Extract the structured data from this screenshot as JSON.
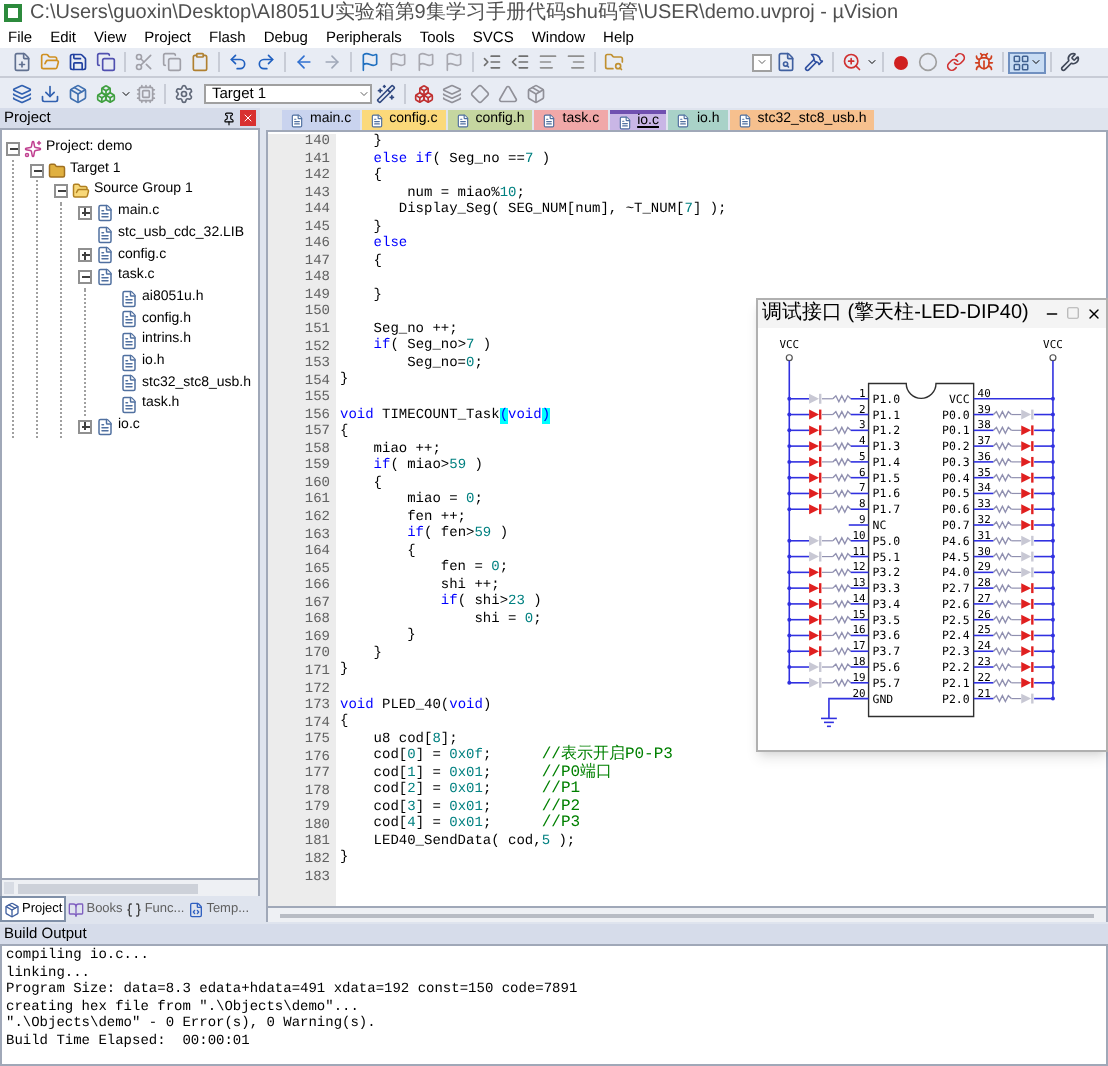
{
  "window": {
    "title": "C:\\Users\\guoxin\\Desktop\\AI8051U实验箱第9集学习手册代码shu码管\\USER\\demo.uvproj - µVision"
  },
  "menu": [
    "File",
    "Edit",
    "View",
    "Project",
    "Flash",
    "Debug",
    "Peripherals",
    "Tools",
    "SVCS",
    "Window",
    "Help"
  ],
  "toolbar": {
    "target": "Target 1"
  },
  "project_panel": {
    "title": "Project",
    "tree": [
      {
        "label": "Project: demo",
        "kind": "project",
        "expanded": true,
        "children": [
          {
            "label": "Target 1",
            "kind": "target",
            "expanded": true,
            "children": [
              {
                "label": "Source Group 1",
                "kind": "group",
                "expanded": true,
                "children": [
                  {
                    "label": "main.c",
                    "kind": "file",
                    "expanded": false
                  },
                  {
                    "label": "stc_usb_cdc_32.LIB",
                    "kind": "file"
                  },
                  {
                    "label": "config.c",
                    "kind": "file",
                    "expanded": false
                  },
                  {
                    "label": "task.c",
                    "kind": "file",
                    "expanded": true,
                    "children": [
                      {
                        "label": "ai8051u.h",
                        "kind": "file"
                      },
                      {
                        "label": "config.h",
                        "kind": "file"
                      },
                      {
                        "label": "intrins.h",
                        "kind": "file"
                      },
                      {
                        "label": "io.h",
                        "kind": "file"
                      },
                      {
                        "label": "stc32_stc8_usb.h",
                        "kind": "file"
                      },
                      {
                        "label": "task.h",
                        "kind": "file"
                      }
                    ]
                  },
                  {
                    "label": "io.c",
                    "kind": "file",
                    "expanded": false
                  }
                ]
              }
            ]
          }
        ]
      }
    ],
    "tabs": [
      {
        "label": "Project",
        "kind": "project",
        "selected": true
      },
      {
        "label": "Books",
        "kind": "books",
        "selected": false
      },
      {
        "label": "Func...",
        "kind": "functions",
        "selected": false
      },
      {
        "label": "Temp...",
        "kind": "templates",
        "selected": false
      }
    ]
  },
  "editor": {
    "tabs": [
      {
        "label": "main.c",
        "color": "#c9d3ee",
        "selected": false
      },
      {
        "label": "config.c",
        "color": "#fbd97a",
        "selected": false
      },
      {
        "label": "config.h",
        "color": "#c5d6a0",
        "selected": false
      },
      {
        "label": "task.c",
        "color": "#f0a8a8",
        "selected": false
      },
      {
        "label": "io.c",
        "color": "#c9b6e6",
        "selected": true
      },
      {
        "label": "io.h",
        "color": "#a9d2c8",
        "selected": false
      },
      {
        "label": "stc32_stc8_usb.h",
        "color": "#f6c08e",
        "selected": false
      }
    ],
    "lines": [
      {
        "number": "140",
        "tokens": [
          {
            "text": "    }",
            "kind": "plain"
          }
        ]
      },
      {
        "number": "141",
        "tokens": [
          {
            "text": "    else if",
            "kind": "keyword"
          },
          {
            "text": "( Seg_no ==",
            "kind": "plain"
          },
          {
            "text": "7",
            "kind": "number"
          },
          {
            "text": " )",
            "kind": "plain"
          }
        ]
      },
      {
        "number": "142",
        "tokens": [
          {
            "text": "    {",
            "kind": "plain"
          }
        ]
      },
      {
        "number": "143",
        "tokens": [
          {
            "text": "        num = miao%",
            "kind": "plain"
          },
          {
            "text": "10",
            "kind": "number"
          },
          {
            "text": ";",
            "kind": "plain"
          }
        ]
      },
      {
        "number": "144",
        "tokens": [
          {
            "text": "       Display_Seg( SEG_NUM[num], ~T_NUM[",
            "kind": "plain"
          },
          {
            "text": "7",
            "kind": "number"
          },
          {
            "text": "] );",
            "kind": "plain"
          }
        ]
      },
      {
        "number": "145",
        "tokens": [
          {
            "text": "    }",
            "kind": "plain"
          }
        ]
      },
      {
        "number": "146",
        "tokens": [
          {
            "text": "    else",
            "kind": "keyword"
          }
        ]
      },
      {
        "number": "147",
        "tokens": [
          {
            "text": "    {",
            "kind": "plain"
          }
        ]
      },
      {
        "number": "148"
      },
      {
        "number": "149",
        "tokens": [
          {
            "text": "    }",
            "kind": "plain"
          }
        ]
      },
      {
        "number": "150"
      },
      {
        "number": "151",
        "tokens": [
          {
            "text": "    Seg_no ++;",
            "kind": "plain"
          }
        ]
      },
      {
        "number": "152",
        "tokens": [
          {
            "text": "    if",
            "kind": "keyword"
          },
          {
            "text": "( Seg_no>",
            "kind": "plain"
          },
          {
            "text": "7",
            "kind": "number"
          },
          {
            "text": " )",
            "kind": "plain"
          }
        ]
      },
      {
        "number": "153",
        "tokens": [
          {
            "text": "        Seg_no=",
            "kind": "plain"
          },
          {
            "text": "0",
            "kind": "number"
          },
          {
            "text": ";",
            "kind": "plain"
          }
        ]
      },
      {
        "number": "154",
        "tokens": [
          {
            "text": "}",
            "kind": "plain"
          }
        ]
      },
      {
        "number": "155"
      },
      {
        "number": "156",
        "tokens": [
          {
            "text": "void",
            "kind": "keyword"
          },
          {
            "text": " TIMECOUNT_Task",
            "kind": "plain"
          },
          {
            "text": "(",
            "kind": "match"
          },
          {
            "text": "void",
            "kind": "keyword"
          },
          {
            "text": ")",
            "kind": "match"
          }
        ]
      },
      {
        "number": "157",
        "tokens": [
          {
            "text": "{",
            "kind": "plain"
          }
        ]
      },
      {
        "number": "158",
        "tokens": [
          {
            "text": "    miao ++;",
            "kind": "plain"
          }
        ]
      },
      {
        "number": "159",
        "tokens": [
          {
            "text": "    if",
            "kind": "keyword"
          },
          {
            "text": "( miao>",
            "kind": "plain"
          },
          {
            "text": "59",
            "kind": "number"
          },
          {
            "text": " )",
            "kind": "plain"
          }
        ]
      },
      {
        "number": "160",
        "tokens": [
          {
            "text": "    {",
            "kind": "plain"
          }
        ]
      },
      {
        "number": "161",
        "tokens": [
          {
            "text": "        miao = ",
            "kind": "plain"
          },
          {
            "text": "0",
            "kind": "number"
          },
          {
            "text": ";",
            "kind": "plain"
          }
        ]
      },
      {
        "number": "162",
        "tokens": [
          {
            "text": "        fen ++;",
            "kind": "plain"
          }
        ]
      },
      {
        "number": "163",
        "tokens": [
          {
            "text": "        if",
            "kind": "keyword"
          },
          {
            "text": "( fen>",
            "kind": "plain"
          },
          {
            "text": "59",
            "kind": "number"
          },
          {
            "text": " )",
            "kind": "plain"
          }
        ]
      },
      {
        "number": "164",
        "tokens": [
          {
            "text": "        {",
            "kind": "plain"
          }
        ]
      },
      {
        "number": "165",
        "tokens": [
          {
            "text": "            fen = ",
            "kind": "plain"
          },
          {
            "text": "0",
            "kind": "number"
          },
          {
            "text": ";",
            "kind": "plain"
          }
        ]
      },
      {
        "number": "166",
        "tokens": [
          {
            "text": "            shi ++;",
            "kind": "plain"
          }
        ]
      },
      {
        "number": "167",
        "tokens": [
          {
            "text": "            if",
            "kind": "keyword"
          },
          {
            "text": "( shi>",
            "kind": "plain"
          },
          {
            "text": "23",
            "kind": "number"
          },
          {
            "text": " )",
            "kind": "plain"
          }
        ]
      },
      {
        "number": "168",
        "tokens": [
          {
            "text": "                shi = ",
            "kind": "plain"
          },
          {
            "text": "0",
            "kind": "number"
          },
          {
            "text": ";",
            "kind": "plain"
          }
        ]
      },
      {
        "number": "169",
        "tokens": [
          {
            "text": "        }",
            "kind": "plain"
          }
        ]
      },
      {
        "number": "170",
        "tokens": [
          {
            "text": "    }",
            "kind": "plain"
          }
        ]
      },
      {
        "number": "171",
        "tokens": [
          {
            "text": "}",
            "kind": "plain"
          }
        ]
      },
      {
        "number": "172"
      },
      {
        "number": "173",
        "tokens": [
          {
            "text": "void",
            "kind": "keyword"
          },
          {
            "text": " PLED_40(",
            "kind": "plain"
          },
          {
            "text": "void",
            "kind": "keyword"
          },
          {
            "text": ")",
            "kind": "plain"
          }
        ]
      },
      {
        "number": "174",
        "tokens": [
          {
            "text": "{",
            "kind": "plain"
          }
        ]
      },
      {
        "number": "175",
        "tokens": [
          {
            "text": "    u8 cod[",
            "kind": "plain"
          },
          {
            "text": "8",
            "kind": "number"
          },
          {
            "text": "];",
            "kind": "plain"
          }
        ]
      },
      {
        "number": "176",
        "tokens": [
          {
            "text": "    cod[",
            "kind": "plain"
          },
          {
            "text": "0",
            "kind": "number"
          },
          {
            "text": "] = ",
            "kind": "plain"
          },
          {
            "text": "0x0f",
            "kind": "number"
          },
          {
            "text": ";      ",
            "kind": "plain"
          },
          {
            "text": "//表示开启P0-P3",
            "kind": "comment"
          }
        ]
      },
      {
        "number": "177",
        "tokens": [
          {
            "text": "    cod[",
            "kind": "plain"
          },
          {
            "text": "1",
            "kind": "number"
          },
          {
            "text": "] = ",
            "kind": "plain"
          },
          {
            "text": "0x01",
            "kind": "number"
          },
          {
            "text": ";      ",
            "kind": "plain"
          },
          {
            "text": "//P0端口",
            "kind": "comment"
          }
        ]
      },
      {
        "number": "178",
        "tokens": [
          {
            "text": "    cod[",
            "kind": "plain"
          },
          {
            "text": "2",
            "kind": "number"
          },
          {
            "text": "] = ",
            "kind": "plain"
          },
          {
            "text": "0x01",
            "kind": "number"
          },
          {
            "text": ";      ",
            "kind": "plain"
          },
          {
            "text": "//P1",
            "kind": "comment"
          }
        ]
      },
      {
        "number": "179",
        "tokens": [
          {
            "text": "    cod[",
            "kind": "plain"
          },
          {
            "text": "3",
            "kind": "number"
          },
          {
            "text": "] = ",
            "kind": "plain"
          },
          {
            "text": "0x01",
            "kind": "number"
          },
          {
            "text": ";      ",
            "kind": "plain"
          },
          {
            "text": "//P2",
            "kind": "comment"
          }
        ]
      },
      {
        "number": "180",
        "tokens": [
          {
            "text": "    cod[",
            "kind": "plain"
          },
          {
            "text": "4",
            "kind": "number"
          },
          {
            "text": "] = ",
            "kind": "plain"
          },
          {
            "text": "0x01",
            "kind": "number"
          },
          {
            "text": ";      ",
            "kind": "plain"
          },
          {
            "text": "//P3",
            "kind": "comment"
          }
        ]
      },
      {
        "number": "181",
        "tokens": [
          {
            "text": "    LED40_SendData( cod,",
            "kind": "plain"
          },
          {
            "text": "5",
            "kind": "number"
          },
          {
            "text": " );",
            "kind": "plain"
          }
        ]
      },
      {
        "number": "182",
        "tokens": [
          {
            "text": "}",
            "kind": "plain"
          }
        ]
      },
      {
        "number": "183"
      }
    ]
  },
  "debug_window": {
    "title": "调试接口 (擎天柱-LED-DIP40)",
    "vcc_labels": [
      "VCC",
      "VCC"
    ],
    "left_pins": [
      {
        "number": "1",
        "label": "P1.0",
        "kind": "io",
        "lit": false
      },
      {
        "number": "2",
        "label": "P1.1",
        "kind": "io",
        "lit": true
      },
      {
        "number": "3",
        "label": "P1.2",
        "kind": "io",
        "lit": true
      },
      {
        "number": "4",
        "label": "P1.3",
        "kind": "io",
        "lit": true
      },
      {
        "number": "5",
        "label": "P1.4",
        "kind": "io",
        "lit": true
      },
      {
        "number": "6",
        "label": "P1.5",
        "kind": "io",
        "lit": true
      },
      {
        "number": "7",
        "label": "P1.6",
        "kind": "io",
        "lit": true
      },
      {
        "number": "8",
        "label": "P1.7",
        "kind": "io",
        "lit": true
      },
      {
        "number": "9",
        "label": "NC",
        "kind": "nc"
      },
      {
        "number": "10",
        "label": "P5.0",
        "kind": "io",
        "lit": false
      },
      {
        "number": "11",
        "label": "P5.1",
        "kind": "io",
        "lit": false
      },
      {
        "number": "12",
        "label": "P3.2",
        "kind": "io",
        "lit": true
      },
      {
        "number": "13",
        "label": "P3.3",
        "kind": "io",
        "lit": true
      },
      {
        "number": "14",
        "label": "P3.4",
        "kind": "io",
        "lit": true
      },
      {
        "number": "15",
        "label": "P3.5",
        "kind": "io",
        "lit": true
      },
      {
        "number": "16",
        "label": "P3.6",
        "kind": "io",
        "lit": true
      },
      {
        "number": "17",
        "label": "P3.7",
        "kind": "io",
        "lit": true
      },
      {
        "number": "18",
        "label": "P5.6",
        "kind": "io",
        "lit": false
      },
      {
        "number": "19",
        "label": "P5.7",
        "kind": "io",
        "lit": false
      },
      {
        "number": "20",
        "label": "GND",
        "kind": "gnd"
      }
    ],
    "right_pins": [
      {
        "number": "40",
        "label": "VCC",
        "kind": "vcc"
      },
      {
        "number": "39",
        "label": "P0.0",
        "kind": "io",
        "lit": false
      },
      {
        "number": "38",
        "label": "P0.1",
        "kind": "io",
        "lit": true
      },
      {
        "number": "37",
        "label": "P0.2",
        "kind": "io",
        "lit": true
      },
      {
        "number": "36",
        "label": "P0.3",
        "kind": "io",
        "lit": true
      },
      {
        "number": "35",
        "label": "P0.4",
        "kind": "io",
        "lit": true
      },
      {
        "number": "34",
        "label": "P0.5",
        "kind": "io",
        "lit": true
      },
      {
        "number": "33",
        "label": "P0.6",
        "kind": "io",
        "lit": true
      },
      {
        "number": "32",
        "label": "P0.7",
        "kind": "io",
        "lit": true
      },
      {
        "number": "31",
        "label": "P4.6",
        "kind": "io",
        "lit": false
      },
      {
        "number": "30",
        "label": "P4.5",
        "kind": "io",
        "lit": false
      },
      {
        "number": "29",
        "label": "P4.0",
        "kind": "io",
        "lit": false
      },
      {
        "number": "28",
        "label": "P2.7",
        "kind": "io",
        "lit": true
      },
      {
        "number": "27",
        "label": "P2.6",
        "kind": "io",
        "lit": true
      },
      {
        "number": "26",
        "label": "P2.5",
        "kind": "io",
        "lit": true
      },
      {
        "number": "25",
        "label": "P2.4",
        "kind": "io",
        "lit": true
      },
      {
        "number": "24",
        "label": "P2.3",
        "kind": "io",
        "lit": true
      },
      {
        "number": "23",
        "label": "P2.2",
        "kind": "io",
        "lit": true
      },
      {
        "number": "22",
        "label": "P2.1",
        "kind": "io",
        "lit": true
      },
      {
        "number": "21",
        "label": "P2.0",
        "kind": "io",
        "lit": false
      }
    ]
  },
  "build_output": {
    "title": "Build Output",
    "lines": [
      "compiling io.c...",
      "linking...",
      "Program Size: data=8.3 edata+hdata=491 xdata=192 const=150 code=7891",
      "creating hex file from \".\\Objects\\demo\"...",
      "\".\\Objects\\demo\" - 0 Error(s), 0 Warning(s).",
      "Build Time Elapsed:  00:00:01"
    ]
  }
}
